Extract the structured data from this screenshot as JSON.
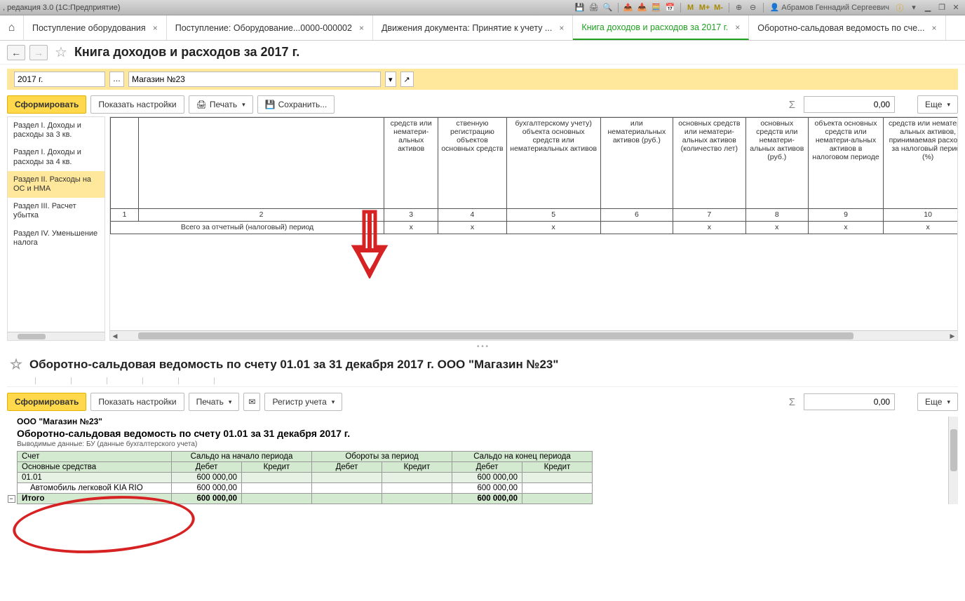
{
  "titlebar": {
    "left": ", редакция 3.0  (1С:Предприятие)",
    "user": "Абрамов Геннадий Сергеевич"
  },
  "tabs": [
    {
      "label": "Поступление оборудования"
    },
    {
      "label": "Поступление: Оборудование...0000-000002"
    },
    {
      "label": "Движения документа: Принятие к учету ..."
    },
    {
      "label": "Книга доходов и расходов за 2017 г.",
      "active": true
    },
    {
      "label": "Оборотно-сальдовая ведомость по сче..."
    }
  ],
  "page1": {
    "title": "Книга доходов и расходов за 2017 г.",
    "period": "2017 г.",
    "org": "Магазин №23",
    "buttons": {
      "form": "Сформировать",
      "show_settings": "Показать настройки",
      "print": "Печать",
      "save": "Сохранить...",
      "more": "Еще"
    },
    "sum": "0,00",
    "sidebar": [
      "Раздел I. Доходы и расходы за 3 кв.",
      "Раздел I. Доходы и расходы за 4 кв.",
      "Раздел II. Расходы на ОС и НМА",
      "Раздел III. Расчет убытка",
      "Раздел IV. Уменьшение налога"
    ],
    "grid_headers": [
      "средств или нематери-альных активов",
      "ственную регистрацию объектов основных средств",
      "бухгалтерскому учету) объекта основных средств или нематериальных активов",
      "или нематериальных активов (руб.)",
      "основных средств или нематери-альных активов (количество лет)",
      "основных средств или нематери-альных активов (руб.)",
      "объекта основных средств или нематери-альных активов в налоговом периоде",
      "средств или нематери-альных активов, принимаемая расходы за налоговый период (%)"
    ],
    "col_nums": [
      "1",
      "2",
      "3",
      "4",
      "5",
      "6",
      "7",
      "8",
      "9",
      "10"
    ],
    "total_label": "Всего за отчетный  (налоговый) период",
    "x": "х"
  },
  "page2": {
    "title": "Оборотно-сальдовая ведомость по счету 01.01 за 31 декабря 2017 г. ООО \"Магазин №23\"",
    "buttons": {
      "form": "Сформировать",
      "show_settings": "Показать настройки",
      "print": "Печать",
      "register": "Регистр учета",
      "more": "Еще"
    },
    "sum": "0,00",
    "org_name": "ООО \"Магазин №23\"",
    "rep_name": "Оборотно-сальдовая ведомость по счету 01.01 за 31 декабря 2017 г.",
    "sub": "Выводимые данные:   БУ (данные бухгалтерского учета)",
    "headers": {
      "account": "Счет",
      "os": "Основные средства",
      "begin": "Сальдо на начало периода",
      "turn": "Обороты за период",
      "end": "Сальдо на конец периода",
      "debit": "Дебет",
      "credit": "Кредит"
    },
    "rows": {
      "acc": "01.01",
      "asset": "Автомобиль легковой KIA RIO",
      "val": "600 000,00",
      "total": "Итого",
      "total_val": "600 000,00"
    }
  }
}
